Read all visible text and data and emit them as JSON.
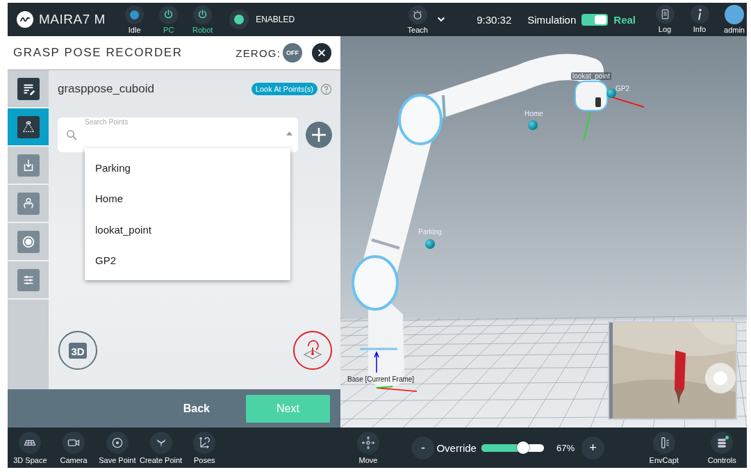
{
  "top_bar": {
    "brand": "MAIRA7 M",
    "status_items": [
      {
        "label": "Idle",
        "kind": "dot"
      },
      {
        "label": "PC",
        "kind": "power"
      },
      {
        "label": "Robot",
        "kind": "power"
      }
    ],
    "enable_status": "ENABLED",
    "mode": "Teach",
    "time": "9:30:32",
    "sim_toggle": {
      "left_label": "Simulation",
      "right_label": "Real",
      "on": true
    },
    "buttons": [
      {
        "label": "Log",
        "kind": "log"
      },
      {
        "label": "Info",
        "kind": "info"
      },
      {
        "label": "admin",
        "kind": "user"
      }
    ]
  },
  "panel": {
    "title": "GRASP POSE RECORDER",
    "zerog_label": "ZEROG:",
    "zerog_state": "OFF",
    "side_tabs": [
      {
        "kind": "edit",
        "selected": false
      },
      {
        "kind": "vision",
        "selected": true
      },
      {
        "kind": "import",
        "selected": false
      },
      {
        "kind": "gripper",
        "selected": false
      },
      {
        "kind": "record",
        "selected": false
      },
      {
        "kind": "settings",
        "selected": false
      }
    ],
    "recording_name": "grasppose_cuboid",
    "look_at_button": "Look At Points(s)",
    "search": {
      "placeholder": "Search Points"
    },
    "dropdown_items": [
      "Parking",
      "Home",
      "lookat_point",
      "GP2"
    ],
    "capture_3d_label": "3D",
    "back_button": "Back",
    "next_button": "Next"
  },
  "viewport": {
    "points": [
      {
        "label": "Home"
      },
      {
        "label": "Parking"
      },
      {
        "label": "lookat_point"
      },
      {
        "label": "GP2"
      }
    ],
    "base_label": "Base [Current Frame]"
  },
  "bottom_bar": {
    "tools": [
      {
        "label": "3D Space",
        "kind": "grid"
      },
      {
        "label": "Camera",
        "kind": "camera"
      },
      {
        "label": "Save Point",
        "kind": "target"
      },
      {
        "label": "Create Point",
        "kind": "pin"
      },
      {
        "label": "Poses",
        "kind": "axes"
      }
    ],
    "move": "Move",
    "override": {
      "label": "Override",
      "minus": "-",
      "plus": "+",
      "level": 0.67,
      "reading": "67%"
    },
    "right_tools": [
      {
        "label": "EnvCapt",
        "kind": "envcapt"
      },
      {
        "label": "Controls",
        "kind": "controls"
      }
    ]
  }
}
